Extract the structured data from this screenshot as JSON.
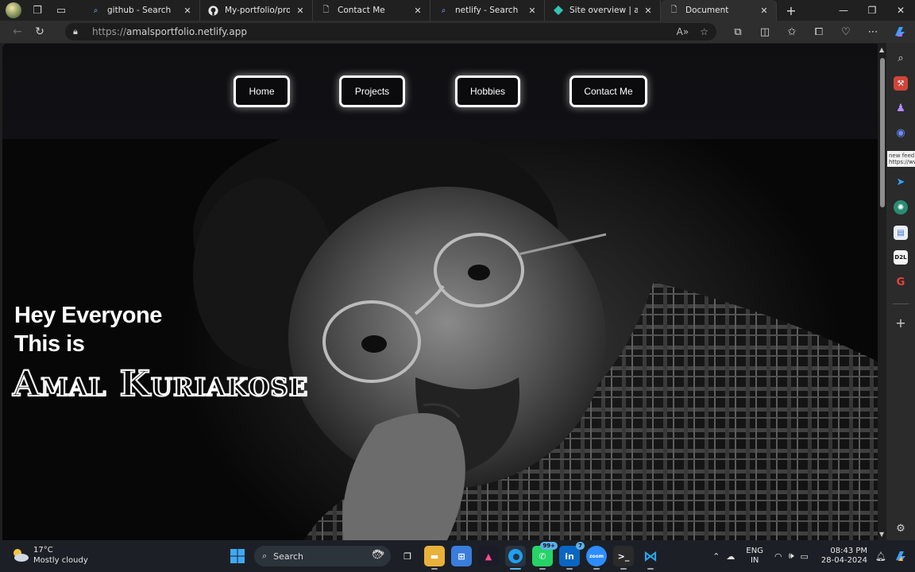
{
  "browser": {
    "tabs": [
      {
        "title": "github - Search",
        "favicon": "bing-search-icon",
        "active": false
      },
      {
        "title": "My-portfolio/projects.h",
        "favicon": "github-icon",
        "active": false
      },
      {
        "title": "Contact Me",
        "favicon": "document-icon",
        "active": false
      },
      {
        "title": "netlify - Search",
        "favicon": "bing-search-icon",
        "active": false
      },
      {
        "title": "Site overview | amalsp",
        "favicon": "netlify-icon",
        "active": false
      },
      {
        "title": "Document",
        "favicon": "document-icon",
        "active": true
      }
    ],
    "url_scheme": "https://",
    "url_host": "amalsportfolio.netlify.app"
  },
  "site": {
    "nav": [
      {
        "label": "Home"
      },
      {
        "label": "Projects"
      },
      {
        "label": "Hobbies"
      },
      {
        "label": "Contact Me"
      }
    ],
    "greeting_line1": "Hey Everyone",
    "greeting_line2": "This is",
    "name": "Amal Kuriakose"
  },
  "edge_sidebar": {
    "tooltip_line1": "new feed",
    "tooltip_line2": "https://ww",
    "d2l_label": "D2L"
  },
  "taskbar": {
    "temperature": "17°C",
    "weather": "Mostly cloudy",
    "search_label": "Search",
    "whatsapp_badge": "99+",
    "linkedin_badge": "7",
    "lang_line1": "ENG",
    "lang_line2": "IN",
    "time": "08:43 PM",
    "date": "28-04-2024"
  },
  "colors": {
    "page_bg": "#0a0a0b",
    "nav_border": "#ffffff",
    "taskbar_bg": "#1c2026",
    "browser_chrome": "#202020"
  }
}
